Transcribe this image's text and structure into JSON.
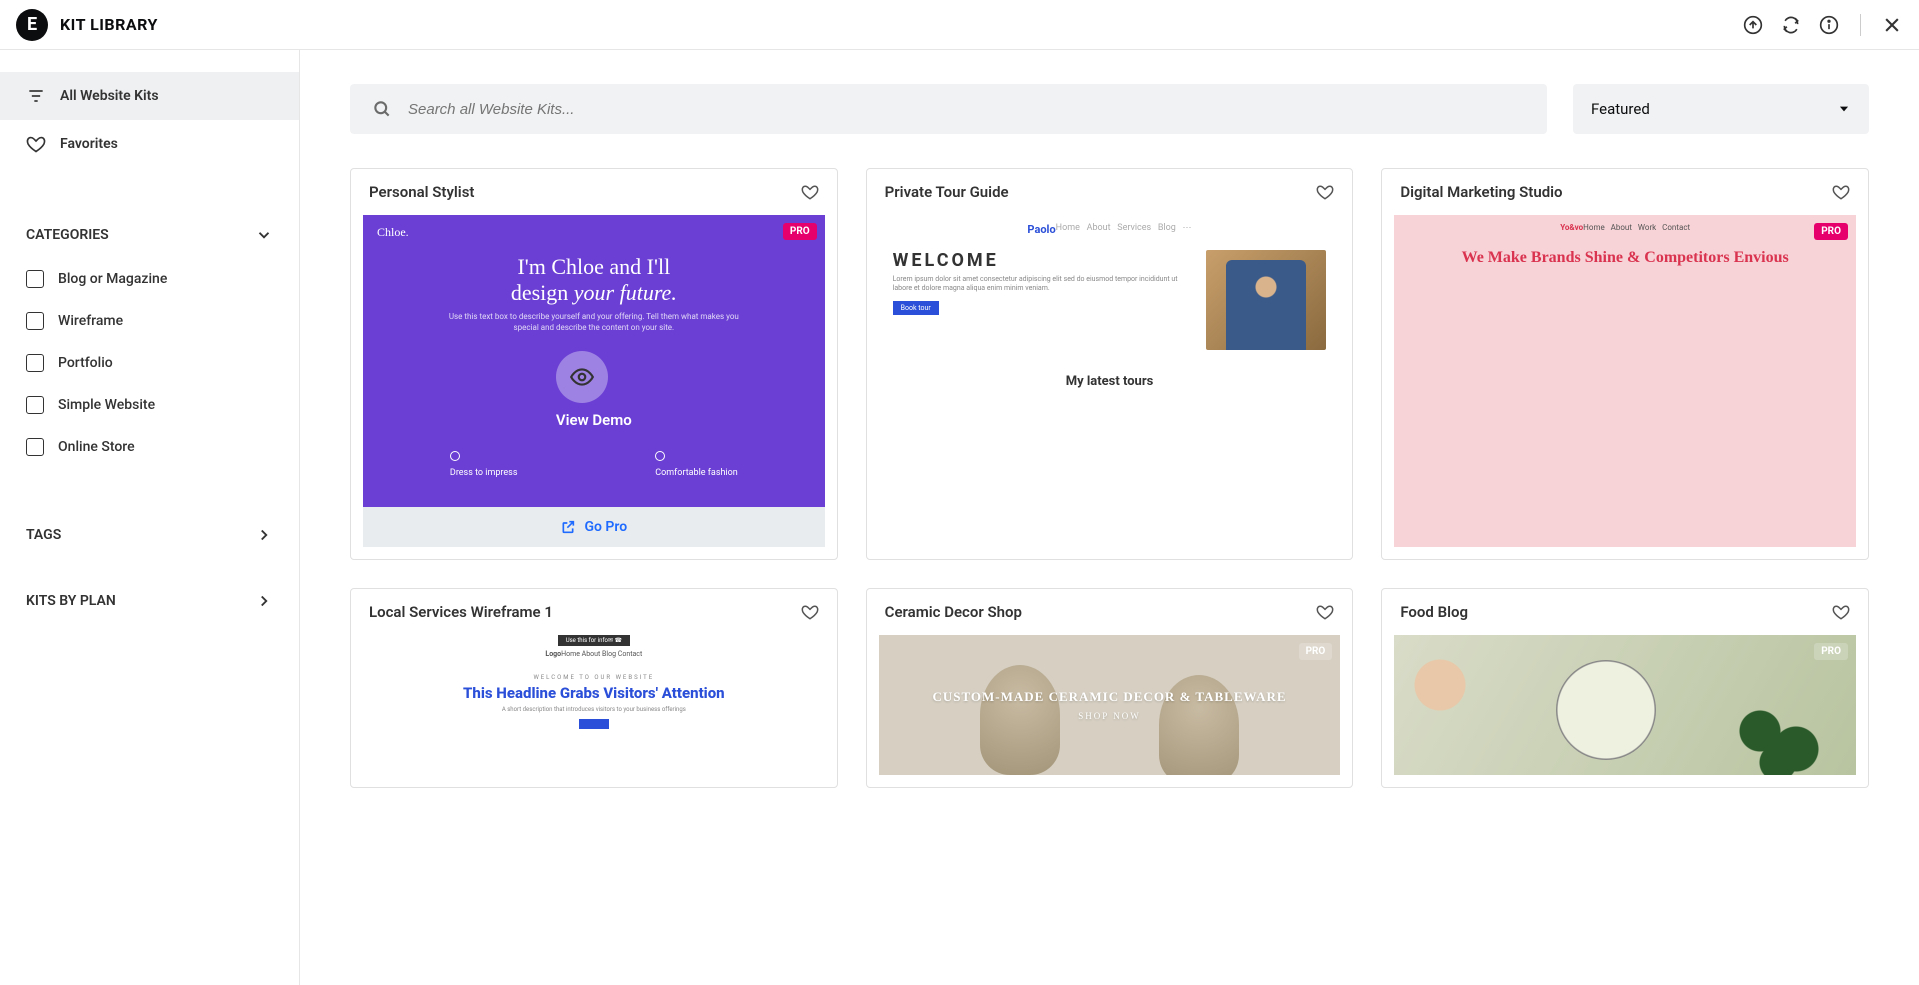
{
  "header": {
    "title": "KIT LIBRARY"
  },
  "sidebar": {
    "all_kits": "All Website Kits",
    "favorites": "Favorites",
    "categories_label": "CATEGORIES",
    "tags_label": "TAGS",
    "plan_label": "KITS BY PLAN",
    "categories": [
      "Blog or Magazine",
      "Wireframe",
      "Portfolio",
      "Simple Website",
      "Online Store"
    ]
  },
  "search": {
    "placeholder": "Search all Website Kits..."
  },
  "sort": {
    "selected": "Featured"
  },
  "overlay": {
    "view_demo": "View Demo",
    "go_pro": "Go Pro"
  },
  "badge": {
    "pro": "PRO"
  },
  "kits": [
    {
      "title": "Personal Stylist",
      "pro": true,
      "preview": {
        "brand": "Chloe.",
        "headline_a": "I'm Chloe and I'll",
        "headline_b": "design ",
        "headline_c": "your future.",
        "sub": "Use this text box to describe yourself and your offering. Tell them what makes you special and describe the content on your site.",
        "feat1": "Dress to impress",
        "feat2": "Comfortable fashion"
      }
    },
    {
      "title": "Private Tour Guide",
      "pro": false,
      "preview": {
        "logo": "Paolo",
        "welcome": "WELCOME",
        "latest": "My latest tours",
        "btn": "Book tour"
      }
    },
    {
      "title": "Digital Marketing Studio",
      "pro": true,
      "preview": {
        "brand": "Yo&vo",
        "headline": "We Make Brands Shine & Competitors Envious"
      }
    },
    {
      "title": "Local Services Wireframe 1",
      "pro": false,
      "preview": {
        "logo": "Logo",
        "eyebrow": "WELCOME TO OUR WEBSITE",
        "headline": "This Headline Grabs Visitors' Attention",
        "sub": "A short description that introduces visitors to your business offerings"
      }
    },
    {
      "title": "Ceramic Decor Shop",
      "pro": true,
      "preview": {
        "headline": "CUSTOM-MADE CERAMIC DECOR & TABLEWARE",
        "cta": "SHOP NOW"
      }
    },
    {
      "title": "Food Blog",
      "pro": true,
      "preview": {}
    }
  ]
}
